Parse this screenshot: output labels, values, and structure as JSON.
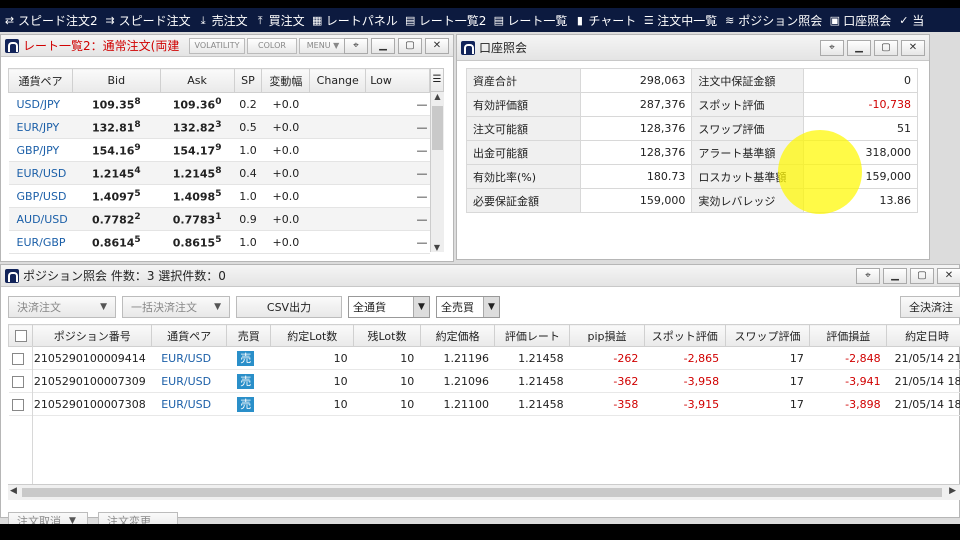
{
  "toolbar": {
    "items": [
      {
        "icon": "speed-order-icon",
        "glyph": "⇄",
        "label": "スピード注文2"
      },
      {
        "icon": "speed-order-icon",
        "glyph": "⇉",
        "label": "スピード注文"
      },
      {
        "icon": "sell-icon",
        "glyph": "⤓",
        "label": "売注文"
      },
      {
        "icon": "buy-icon",
        "glyph": "⤒",
        "label": "買注文"
      },
      {
        "icon": "rate-panel-icon",
        "glyph": "▦",
        "label": "レートパネル"
      },
      {
        "icon": "rate-list2-icon",
        "glyph": "▤",
        "label": "レート一覧2"
      },
      {
        "icon": "rate-list-icon",
        "glyph": "▤",
        "label": "レート一覧"
      },
      {
        "icon": "chart-icon",
        "glyph": "▮",
        "label": "チャート"
      },
      {
        "icon": "order-list-icon",
        "glyph": "☰",
        "label": "注文中一覧"
      },
      {
        "icon": "position-icon",
        "glyph": "≋",
        "label": "ポジション照会"
      },
      {
        "icon": "account-icon",
        "glyph": "▣",
        "label": "口座照会"
      },
      {
        "icon": "current-icon",
        "glyph": "✓",
        "label": "当"
      }
    ]
  },
  "rate_pane": {
    "title": "レート一覧2：通常注文(両建",
    "buttons": {
      "volatility": "VOLATILITY",
      "color": "COLOR",
      "menu": "MENU ▼"
    },
    "columns": [
      "通貨ペア",
      "Bid",
      "Ask",
      "SP",
      "変動幅",
      "Change",
      "Low"
    ],
    "rows": [
      {
        "pair": "USD/JPY",
        "bid": "109.35",
        "bid_s": "8",
        "ask": "109.36",
        "ask_s": "0",
        "sp": "0.2",
        "chg": "+0.0",
        "low": "—"
      },
      {
        "pair": "EUR/JPY",
        "bid": "132.81",
        "bid_s": "8",
        "ask": "132.82",
        "ask_s": "3",
        "sp": "0.5",
        "chg": "+0.0",
        "low": "—"
      },
      {
        "pair": "GBP/JPY",
        "bid": "154.16",
        "bid_s": "9",
        "ask": "154.17",
        "ask_s": "9",
        "sp": "1.0",
        "chg": "+0.0",
        "low": "—"
      },
      {
        "pair": "EUR/USD",
        "bid": "1.2145",
        "bid_s": "4",
        "ask": "1.2145",
        "ask_s": "8",
        "sp": "0.4",
        "chg": "+0.0",
        "low": "—"
      },
      {
        "pair": "GBP/USD",
        "bid": "1.4097",
        "bid_s": "5",
        "ask": "1.4098",
        "ask_s": "5",
        "sp": "1.0",
        "chg": "+0.0",
        "low": "—"
      },
      {
        "pair": "AUD/USD",
        "bid": "0.7782",
        "bid_s": "2",
        "ask": "0.7783",
        "ask_s": "1",
        "sp": "0.9",
        "chg": "+0.0",
        "low": "—"
      },
      {
        "pair": "EUR/GBP",
        "bid": "0.8614",
        "bid_s": "5",
        "ask": "0.8615",
        "ask_s": "5",
        "sp": "1.0",
        "chg": "+0.0",
        "low": "—"
      }
    ]
  },
  "account_pane": {
    "title": "口座照会",
    "rows": [
      {
        "l1": "資産合計",
        "v1": "298,063",
        "l2": "注文中保証金額",
        "v2": "0"
      },
      {
        "l1": "有効評価額",
        "v1": "287,376",
        "l2": "スポット評価",
        "v2": "-10,738"
      },
      {
        "l1": "注文可能額",
        "v1": "128,376",
        "l2": "スワップ評価",
        "v2": "51"
      },
      {
        "l1": "出金可能額",
        "v1": "128,376",
        "l2": "アラート基準額",
        "v2": "318,000"
      },
      {
        "l1": "有効比率(%)",
        "v1": "180.73",
        "l2": "ロスカット基準額",
        "v2": "159,000"
      },
      {
        "l1": "必要保証金額",
        "v1": "159,000",
        "l2": "実効レバレッジ",
        "v2": "13.86"
      }
    ]
  },
  "position_pane": {
    "title": "ポジション照会 件数：3 選択件数：0",
    "toolbar": {
      "settle": "決済注文",
      "bulk_settle": "一括決済注文",
      "csv": "CSV出力",
      "currency_select": "全通貨",
      "side_select": "全売買",
      "all_settle": "全決済注"
    },
    "columns": [
      "ポジション番号",
      "通貨ペア",
      "売買",
      "約定Lot数",
      "残Lot数",
      "約定価格",
      "評価レート",
      "pip損益",
      "スポット評価",
      "スワップ評価",
      "評価損益",
      "約定日時"
    ],
    "rows": [
      {
        "id": "2105290100009414",
        "pair": "EUR/USD",
        "side": "売",
        "lot": "10",
        "rem": "10",
        "price": "1.21196",
        "rate": "1.21458",
        "pip": "-262",
        "spot": "-2,865",
        "swap": "17",
        "pnl": "-2,848",
        "date": "21/05/14 21"
      },
      {
        "id": "2105290100007309",
        "pair": "EUR/USD",
        "side": "売",
        "lot": "10",
        "rem": "10",
        "price": "1.21096",
        "rate": "1.21458",
        "pip": "-362",
        "spot": "-3,958",
        "swap": "17",
        "pnl": "-3,941",
        "date": "21/05/14 18"
      },
      {
        "id": "2105290100007308",
        "pair": "EUR/USD",
        "side": "売",
        "lot": "10",
        "rem": "10",
        "price": "1.21100",
        "rate": "1.21458",
        "pip": "-358",
        "spot": "-3,915",
        "swap": "17",
        "pnl": "-3,898",
        "date": "21/05/14 18"
      }
    ]
  },
  "bottom": {
    "cancel": "注文取消",
    "modify": "注文変更"
  }
}
